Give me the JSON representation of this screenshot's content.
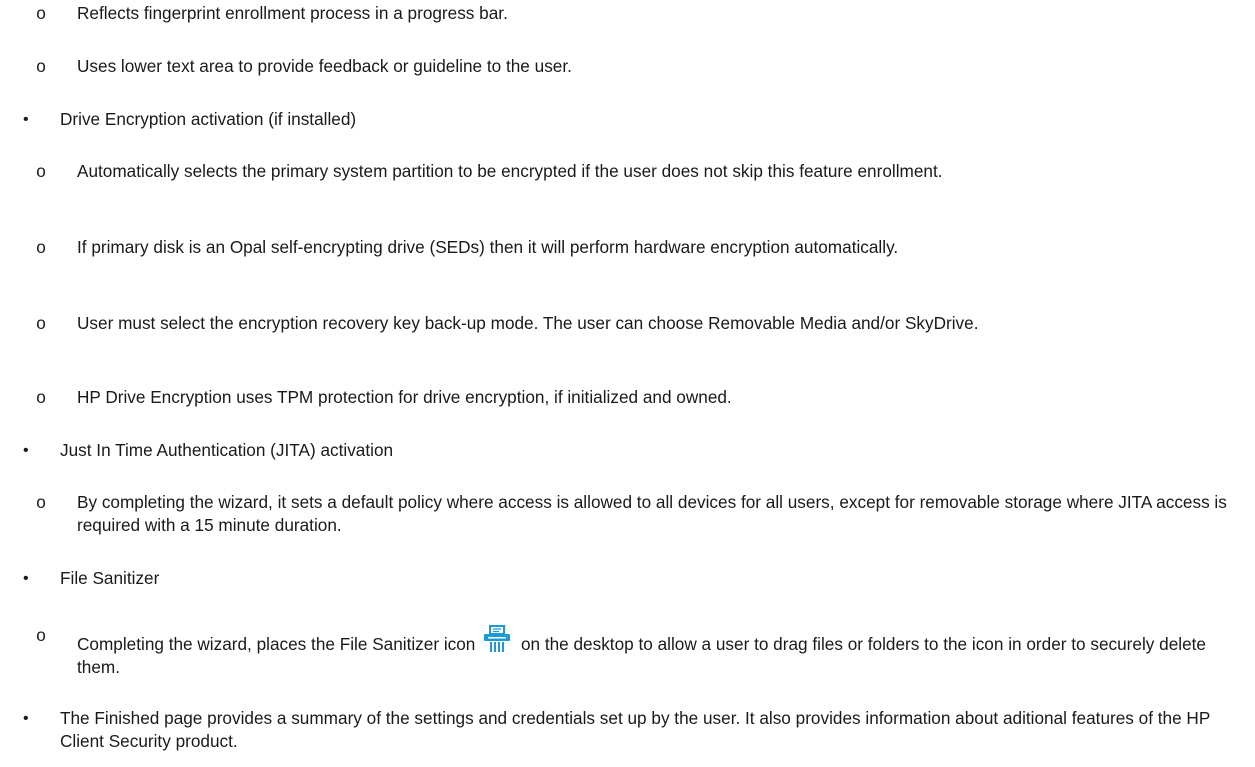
{
  "items": [
    {
      "type": "sub",
      "text": "Reflects fingerprint enrollment process in a progress bar."
    },
    {
      "type": "sub",
      "text": "Uses lower text area to provide feedback or guideline to the user."
    },
    {
      "type": "bullet",
      "text": "Drive Encryption activation (if installed)"
    },
    {
      "type": "sub",
      "text": "Automatically selects the primary system partition to be encrypted if the user does not skip this feature enrollment."
    },
    {
      "type": "sub",
      "text": "If primary disk is an Opal self-encrypting drive (SEDs) then it will perform hardware encryption automatically."
    },
    {
      "type": "sub",
      "text": "User must select the encryption recovery key back-up mode. The user can choose Removable Media and/or SkyDrive."
    },
    {
      "type": "sub",
      "text": "HP Drive Encryption uses TPM protection for drive encryption, if initialized and owned."
    },
    {
      "type": "bullet",
      "text": "Just In Time Authentication (JITA) activation"
    },
    {
      "type": "sub",
      "text": "By completing the wizard, it sets a default policy where access is allowed to all devices for all users, except for removable storage where JITA access is required with a 15 minute duration."
    },
    {
      "type": "bullet",
      "text": "File Sanitizer"
    },
    {
      "type": "sub-icon",
      "text_before": "Completing the wizard, places the File Sanitizer icon",
      "text_after": "on the desktop to allow a user to drag files or folders to the icon in order to securely delete them.",
      "icon": "file-sanitizer-icon"
    },
    {
      "type": "bullet",
      "text": "The Finished page provides a summary of the settings and credentials set up by the user. It also provides information about aditional features of the HP Client Security product."
    }
  ],
  "markers": {
    "sub": "o",
    "bullet": "•"
  },
  "colors": {
    "text": "#1a1a1a",
    "icon_blue": "#1b9ad6"
  }
}
